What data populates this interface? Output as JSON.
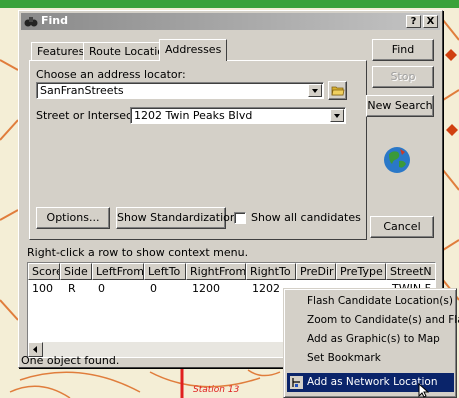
{
  "dialog": {
    "title": "Find",
    "help_button": "?",
    "close_button": "X"
  },
  "tabs": [
    {
      "label": "Features",
      "active": false
    },
    {
      "label": "Route Locations",
      "active": false
    },
    {
      "label": "Addresses",
      "active": true
    }
  ],
  "form": {
    "locator_label": "Choose an address locator:",
    "locator_value": "SanFranStreets",
    "street_label": "Street or Intersection:",
    "street_value": "1202 Twin Peaks Blvd"
  },
  "buttons": {
    "find": "Find",
    "stop": "Stop",
    "new_search": "New Search",
    "options": "Options...",
    "show_standardization": "Show Standardization",
    "cancel": "Cancel"
  },
  "show_all_candidates": {
    "label": "Show all candidates",
    "checked": false
  },
  "hint": "Right-click a row to show context menu.",
  "results": {
    "columns": [
      "Score",
      "Side",
      "LeftFrom",
      "LeftTo",
      "RightFrom",
      "RightTo",
      "PreDir",
      "PreType",
      "StreetN"
    ],
    "rows": [
      [
        "100",
        "R",
        "0",
        "0",
        "1200",
        "1202",
        "",
        "",
        "TWIN F"
      ]
    ]
  },
  "status": "One object found.",
  "context_menu": {
    "items": [
      {
        "label": "Flash Candidate Location(s)",
        "selected": false
      },
      {
        "label": "Zoom to Candidate(s) and Flash",
        "selected": false
      },
      {
        "label": "Add as Graphic(s) to Map",
        "selected": false
      },
      {
        "label": "Set Bookmark",
        "selected": false
      },
      {
        "label": "Add as Network Location",
        "selected": true
      }
    ]
  },
  "map": {
    "label": "Station 13",
    "colors": {
      "background": "#f4eed6",
      "road": "#e07d3c",
      "route": "#e02020",
      "station": "#d04010"
    }
  }
}
